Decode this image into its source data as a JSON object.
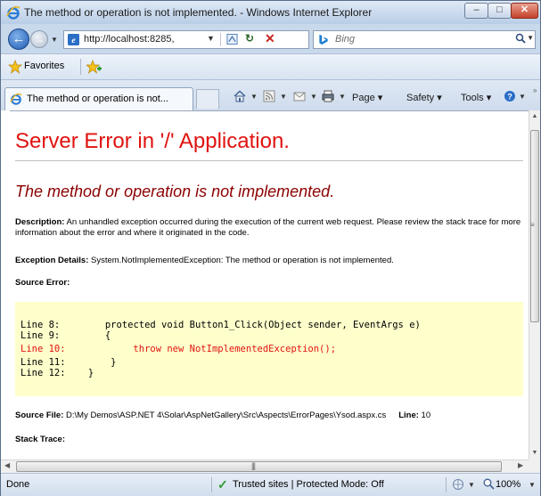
{
  "window": {
    "title": "The method or operation is not implemented. - Windows Internet Explorer",
    "minimize": "–",
    "maximize": "□",
    "close": "✕"
  },
  "address": {
    "url": "http://localhost:8285,",
    "search_placeholder": "Bing"
  },
  "favorites": {
    "label": "Favorites"
  },
  "tab": {
    "label": "The method or operation is not..."
  },
  "commandbar": {
    "page": "Page",
    "safety": "Safety",
    "tools": "Tools"
  },
  "page": {
    "heading": "Server Error in '/' Application.",
    "error_message": "The method or operation is not implemented.",
    "description_label": "Description:",
    "description_text": " An unhandled exception occurred during the execution of the current web request. Please review the stack trace for more information about the error and where it originated in the code.",
    "exception_label": "Exception Details:",
    "exception_text": " System.NotImplementedException: The method or operation is not implemented.",
    "source_error_label": "Source Error:",
    "code_lines": [
      {
        "line": "Line 8:",
        "code": "        protected void Button1_Click(Object sender, EventArgs e)",
        "highlight": false
      },
      {
        "line": "Line 9:",
        "code": "        {",
        "highlight": false
      },
      {
        "line": "Line 10:",
        "code": "            throw new NotImplementedException();",
        "highlight": true
      },
      {
        "line": "Line 11:",
        "code": "        }",
        "highlight": false
      },
      {
        "line": "Line 12:",
        "code": "    }",
        "highlight": false
      }
    ],
    "source_file_label": "Source File:",
    "source_file_path": " D:\\My Demos\\ASP.NET 4\\Solar\\AspNetGallery\\Src\\Aspects\\ErrorPages\\Ysod.aspx.cs",
    "line_label": "Line:",
    "line_value": " 10",
    "stack_trace_label": "Stack Trace:"
  },
  "status": {
    "done": "Done",
    "zone": "Trusted sites | Protected Mode: Off",
    "zoom": "100%"
  },
  "colors": {
    "error_red": "#e0130f",
    "dark_red": "#8c0000",
    "code_bg": "#ffffcc"
  }
}
